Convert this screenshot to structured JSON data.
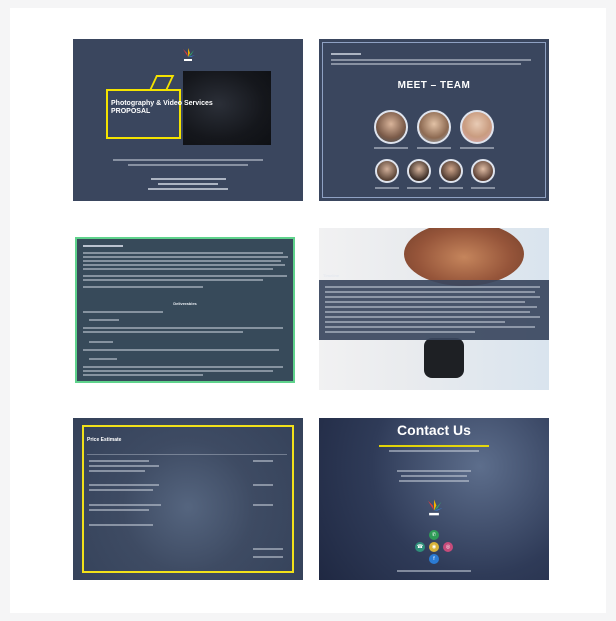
{
  "slides": [
    {
      "name": "cover",
      "title": "Photography & Video Services PROPOSAL"
    },
    {
      "name": "team",
      "heading": "MEET – TEAM"
    },
    {
      "name": "scope",
      "heading": "Deliverables"
    },
    {
      "name": "timeline",
      "heading": "Timeline"
    },
    {
      "name": "price",
      "heading": "Price Estimate"
    },
    {
      "name": "contact",
      "heading": "Contact Us"
    }
  ],
  "colors": {
    "navy": "#3a465e",
    "yellow": "#f4e300",
    "green_border": "#5fd28c"
  }
}
